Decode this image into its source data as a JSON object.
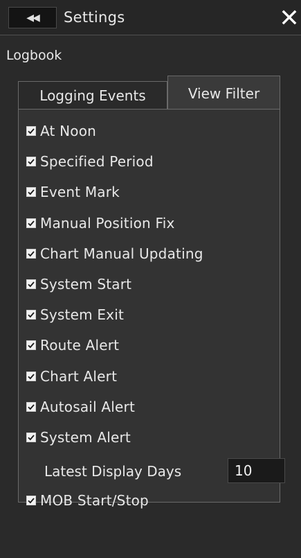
{
  "window": {
    "title": "Settings",
    "back_icon": "double-left-arrow-icon",
    "close_icon": "close-icon"
  },
  "section": {
    "label": "Logbook"
  },
  "tabs": [
    {
      "label": "Logging Events",
      "active": false
    },
    {
      "label": "View Filter",
      "active": true
    }
  ],
  "filters": [
    {
      "label": "At Noon",
      "checked": true
    },
    {
      "label": "Specified Period",
      "checked": true
    },
    {
      "label": "Event Mark",
      "checked": true
    },
    {
      "label": "Manual Position Fix",
      "checked": true
    },
    {
      "label": "Chart Manual Updating",
      "checked": true
    },
    {
      "label": "System Start",
      "checked": true
    },
    {
      "label": "System Exit",
      "checked": true
    },
    {
      "label": "Route Alert",
      "checked": true
    },
    {
      "label": "Chart Alert",
      "checked": true
    },
    {
      "label": "Autosail Alert",
      "checked": true
    },
    {
      "label": "System Alert",
      "checked": true
    }
  ],
  "latest_display_days": {
    "label": "Latest Display Days",
    "value": "10"
  },
  "mob_filter": {
    "label": "MOB Start/Stop",
    "checked": true
  },
  "colors": {
    "background": "#2a2a2a",
    "content": "#333333",
    "text": "#e8e8e8"
  }
}
